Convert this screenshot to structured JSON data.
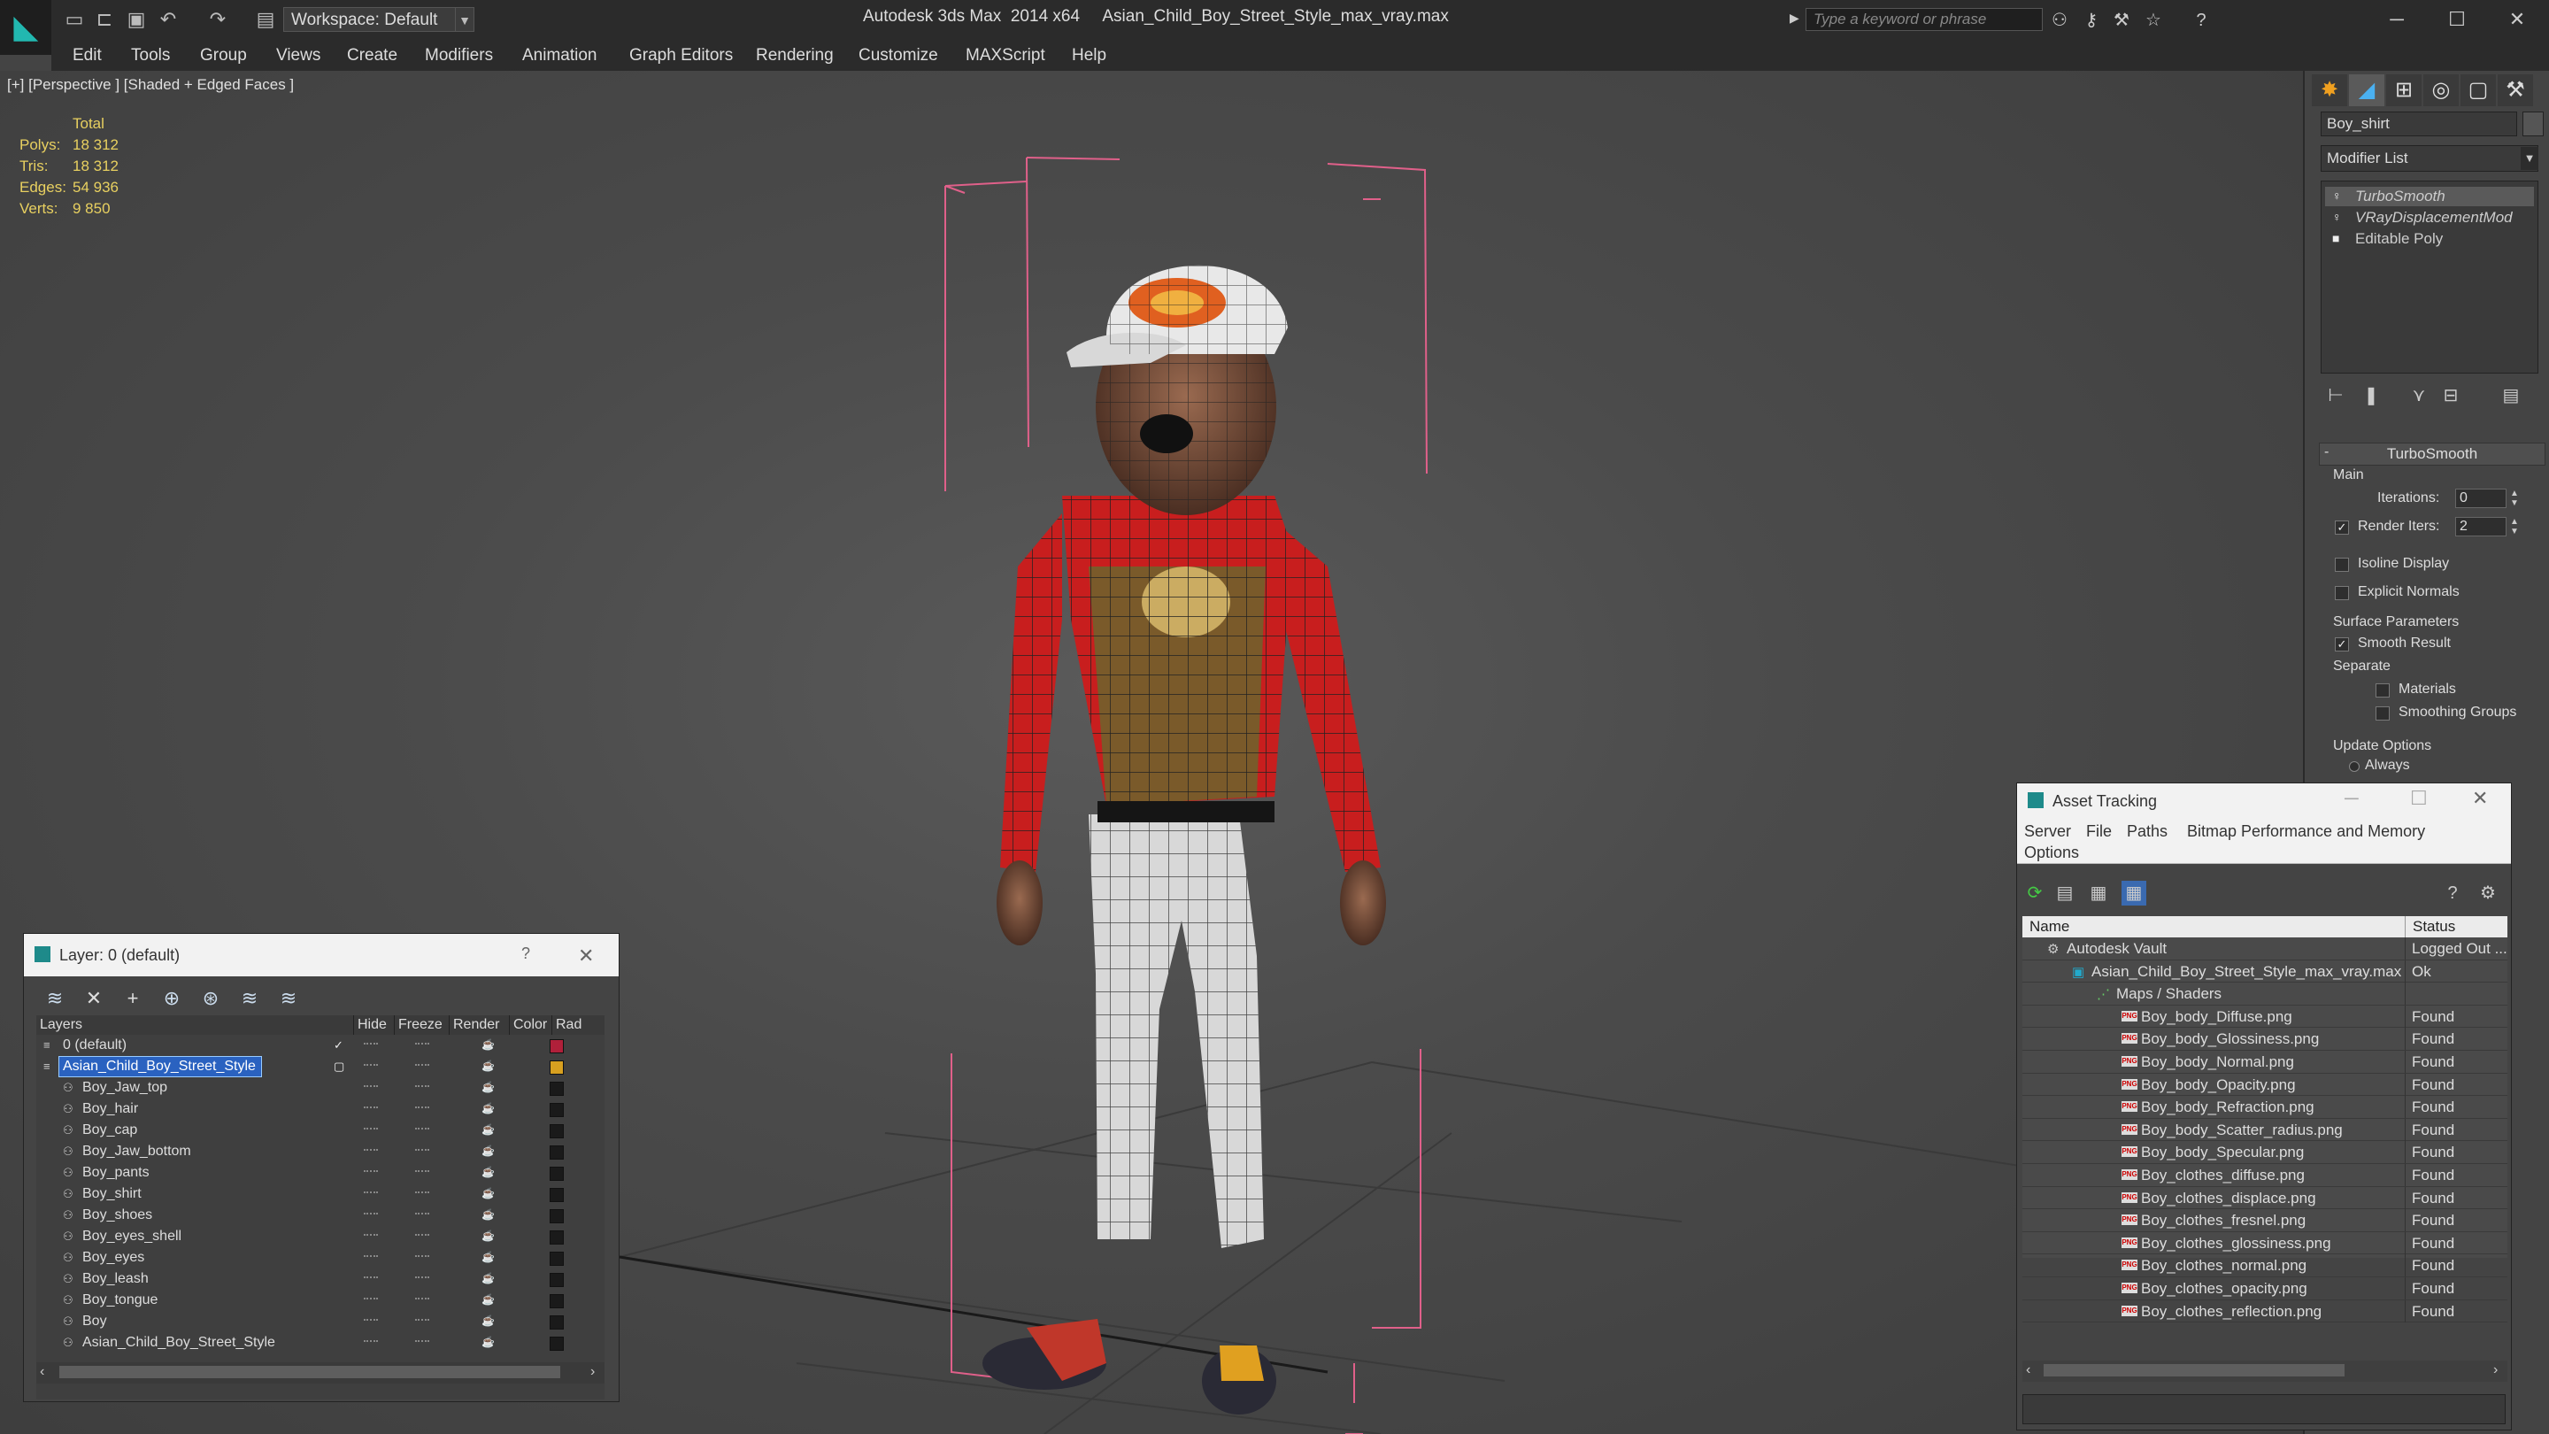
{
  "titlebar": {
    "workspace": "Workspace: Default",
    "app_title": "Autodesk 3ds Max  2014 x64     Asian_Child_Boy_Street_Style_max_vray.max",
    "search_placeholder": "Type a keyword or phrase"
  },
  "menubar": [
    "Edit",
    "Tools",
    "Group",
    "Views",
    "Create",
    "Modifiers",
    "Animation",
    "Graph Editors",
    "Rendering",
    "Customize",
    "MAXScript",
    "Help"
  ],
  "viewport": {
    "label": "[+] [Perspective ] [Shaded + Edged Faces ]",
    "stats": {
      "header": "Total",
      "rows": [
        {
          "label": "Polys:",
          "value": "18 312"
        },
        {
          "label": "Tris:",
          "value": "18 312"
        },
        {
          "label": "Edges:",
          "value": "54 936"
        },
        {
          "label": "Verts:",
          "value": "9 850"
        }
      ]
    }
  },
  "command_panel": {
    "object_name": "Boy_shirt",
    "modifier_list": "Modifier List",
    "stack": [
      "TurboSmooth",
      "VRayDisplacementMod",
      "Editable Poly"
    ],
    "rollout_title": "TurboSmooth",
    "main_group": "Main",
    "iterations_label": "Iterations:",
    "iterations_value": "0",
    "render_iters_label": "Render Iters:",
    "render_iters_value": "2",
    "isoline": "Isoline Display",
    "explicit_normals": "Explicit Normals",
    "surface_group": "Surface Parameters",
    "smooth_result": "Smooth Result",
    "separate": "Separate",
    "materials": "Materials",
    "smoothing_groups": "Smoothing Groups",
    "update_group": "Update Options",
    "always": "Always"
  },
  "layer_dialog": {
    "title": "Layer: 0 (default)",
    "columns": [
      "Layers",
      "Hide",
      "Freeze",
      "Render",
      "Color",
      "Rad"
    ],
    "rows": [
      {
        "name": "0 (default)",
        "color": "#b0203a",
        "level": 0
      },
      {
        "name": "Asian_Child_Boy_Street_Style",
        "color": "#d8a020",
        "level": 0
      },
      {
        "name": "Boy_Jaw_top",
        "color": "#1a1a1a",
        "level": 1
      },
      {
        "name": "Boy_hair",
        "color": "#1a1a1a",
        "level": 1
      },
      {
        "name": "Boy_cap",
        "color": "#1a1a1a",
        "level": 1
      },
      {
        "name": "Boy_Jaw_bottom",
        "color": "#1a1a1a",
        "level": 1
      },
      {
        "name": "Boy_pants",
        "color": "#1a1a1a",
        "level": 1
      },
      {
        "name": "Boy_shirt",
        "color": "#1a1a1a",
        "level": 1
      },
      {
        "name": "Boy_shoes",
        "color": "#1a1a1a",
        "level": 1
      },
      {
        "name": "Boy_eyes_shell",
        "color": "#1a1a1a",
        "level": 1
      },
      {
        "name": "Boy_eyes",
        "color": "#1a1a1a",
        "level": 1
      },
      {
        "name": "Boy_leash",
        "color": "#1a1a1a",
        "level": 1
      },
      {
        "name": "Boy_tongue",
        "color": "#1a1a1a",
        "level": 1
      },
      {
        "name": "Boy",
        "color": "#1a1a1a",
        "level": 1
      },
      {
        "name": "Asian_Child_Boy_Street_Style",
        "color": "#1a1a1a",
        "level": 1
      }
    ]
  },
  "asset_dialog": {
    "title": "Asset Tracking",
    "menus": [
      "Server",
      "File",
      "Paths",
      "Bitmap Performance and Memory",
      "Options"
    ],
    "columns": [
      "Name",
      "Status"
    ],
    "rows": [
      {
        "name": "Autodesk Vault",
        "status": "Logged Out ...",
        "level": 0
      },
      {
        "name": "Asian_Child_Boy_Street_Style_max_vray.max",
        "status": "Ok",
        "level": 1
      },
      {
        "name": "Maps / Shaders",
        "status": "",
        "level": 2
      },
      {
        "name": "Boy_body_Diffuse.png",
        "status": "Found",
        "level": 3
      },
      {
        "name": "Boy_body_Glossiness.png",
        "status": "Found",
        "level": 3
      },
      {
        "name": "Boy_body_Normal.png",
        "status": "Found",
        "level": 3
      },
      {
        "name": "Boy_body_Opacity.png",
        "status": "Found",
        "level": 3
      },
      {
        "name": "Boy_body_Refraction.png",
        "status": "Found",
        "level": 3
      },
      {
        "name": "Boy_body_Scatter_radius.png",
        "status": "Found",
        "level": 3
      },
      {
        "name": "Boy_body_Specular.png",
        "status": "Found",
        "level": 3
      },
      {
        "name": "Boy_clothes_diffuse.png",
        "status": "Found",
        "level": 3
      },
      {
        "name": "Boy_clothes_displace.png",
        "status": "Found",
        "level": 3
      },
      {
        "name": "Boy_clothes_fresnel.png",
        "status": "Found",
        "level": 3
      },
      {
        "name": "Boy_clothes_glossiness.png",
        "status": "Found",
        "level": 3
      },
      {
        "name": "Boy_clothes_normal.png",
        "status": "Found",
        "level": 3
      },
      {
        "name": "Boy_clothes_opacity.png",
        "status": "Found",
        "level": 3
      },
      {
        "name": "Boy_clothes_reflection.png",
        "status": "Found",
        "level": 3
      }
    ]
  },
  "colors": {
    "accent": "#22b8b0",
    "selection": "#2a62c0",
    "stats": "#e8d060"
  }
}
